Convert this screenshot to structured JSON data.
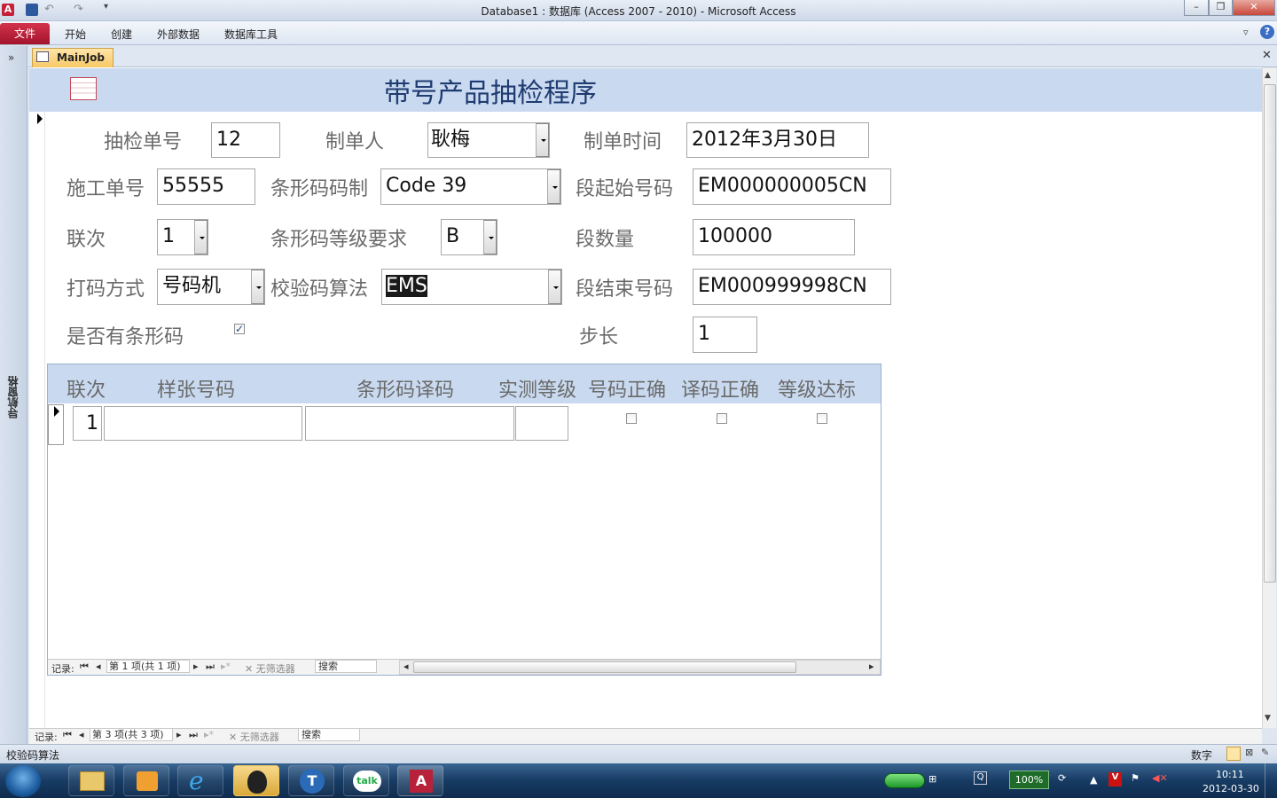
{
  "window": {
    "title": "Database1 : 数据库 (Access 2007 - 2010)  -  Microsoft Access"
  },
  "ribbon": {
    "file": "文件",
    "tabs": [
      "开始",
      "创建",
      "外部数据",
      "数据库工具"
    ]
  },
  "nav_pane": {
    "label": "导航窗格",
    "toggle": "»"
  },
  "doc_tab": {
    "label": "MainJob"
  },
  "form": {
    "title": "带号产品抽检程序",
    "fields": {
      "inspect_no": {
        "label": "抽检单号",
        "value": "12"
      },
      "creator": {
        "label": "制单人",
        "value": "耿梅"
      },
      "create_time": {
        "label": "制单时间",
        "value": "2012年3月30日"
      },
      "work_no": {
        "label": "施工单号",
        "value": "55555"
      },
      "barcode_std": {
        "label": "条形码码制",
        "value": "Code 39"
      },
      "seg_start": {
        "label": "段起始号码",
        "value": "EM000000005CN"
      },
      "copy_no": {
        "label": "联次",
        "value": "1"
      },
      "grade_req": {
        "label": "条形码等级要求",
        "value": "B"
      },
      "seg_count": {
        "label": "段数量",
        "value": "100000"
      },
      "print_mode": {
        "label": "打码方式",
        "value": "号码机"
      },
      "check_alg": {
        "label": "校验码算法",
        "value": "EMS"
      },
      "seg_end": {
        "label": "段结束号码",
        "value": "EM000999998CN"
      },
      "has_barcode": {
        "label": "是否有条形码",
        "checked": true
      },
      "step": {
        "label": "步长",
        "value": "1"
      }
    },
    "subform": {
      "columns": [
        "联次",
        "样张号码",
        "条形码译码",
        "实测等级",
        "号码正确",
        "译码正确",
        "等级达标"
      ],
      "rows": [
        {
          "copy": "1",
          "sample": "",
          "decode": "",
          "grade": "",
          "num_ok": false,
          "dec_ok": false,
          "grade_ok": false
        }
      ],
      "nav": {
        "record_label": "记录:",
        "position": "第 1 项(共 1 项)",
        "filter": "无筛选器",
        "search": "搜索"
      }
    },
    "nav": {
      "record_label": "记录:",
      "position": "第 3 项(共 3 项)",
      "filter": "无筛选器",
      "search": "搜索"
    }
  },
  "status": {
    "left": "校验码算法",
    "right": "数字"
  },
  "tray": {
    "battery": "100%",
    "time": "10:11",
    "date": "2012-03-30"
  }
}
